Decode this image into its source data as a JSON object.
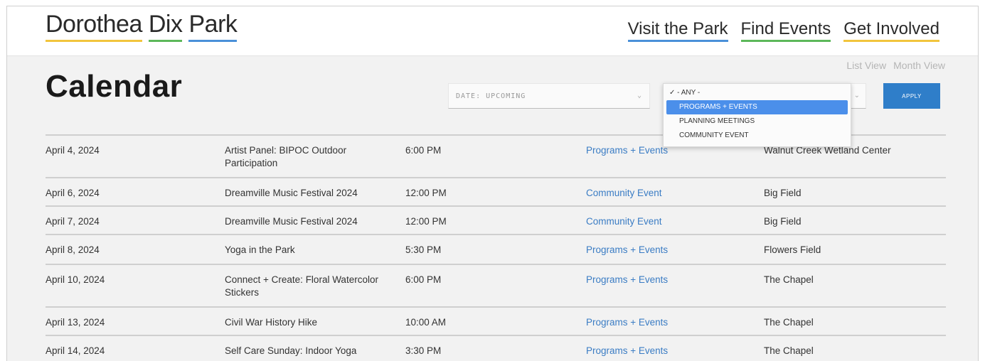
{
  "header": {
    "logo_words": [
      "Dorothea",
      "Dix",
      "Park"
    ],
    "nav": [
      "Visit the Park",
      "Find Events",
      "Get Involved"
    ]
  },
  "page": {
    "title": "Calendar",
    "views": [
      "List View",
      "Month View"
    ]
  },
  "filters": {
    "date_select_value": "DATE: UPCOMING",
    "apply_label": "APPLY",
    "type_options": [
      "✓ - ANY -",
      "PROGRAMS + EVENTS",
      "PLANNING MEETINGS",
      "COMMUNITY EVENT"
    ],
    "highlighted_option": "PROGRAMS + EVENTS"
  },
  "colors": {
    "logo_underlines": [
      "#f2c53d",
      "#5db85a",
      "#4a90d9"
    ],
    "nav_underlines": [
      "#4a90d9",
      "#5db85a",
      "#f2c53d"
    ],
    "apply_button": "#2f7ec9",
    "category_link": "#3a7cc4",
    "dropdown_highlight": "#4b8fea"
  },
  "events": [
    {
      "date": "April 4, 2024",
      "title": "Artist Panel: BIPOC Outdoor Participation",
      "time": "6:00 PM",
      "category": "Programs + Events",
      "location": "Walnut Creek Wetland Center"
    },
    {
      "date": "April 6, 2024",
      "title": "Dreamville Music Festival 2024",
      "time": "12:00 PM",
      "category": "Community Event",
      "location": "Big Field"
    },
    {
      "date": "April 7, 2024",
      "title": "Dreamville Music Festival 2024",
      "time": "12:00 PM",
      "category": "Community Event",
      "location": "Big Field"
    },
    {
      "date": "April 8, 2024",
      "title": "Yoga in the Park",
      "time": "5:30 PM",
      "category": "Programs + Events",
      "location": "Flowers Field"
    },
    {
      "date": "April 10, 2024",
      "title": "Connect + Create: Floral Watercolor Stickers",
      "time": "6:00 PM",
      "category": "Programs + Events",
      "location": "The Chapel"
    },
    {
      "date": "April 13, 2024",
      "title": "Civil War History Hike",
      "time": "10:00 AM",
      "category": "Programs + Events",
      "location": "The Chapel"
    },
    {
      "date": "April 14, 2024",
      "title": "Self Care Sunday: Indoor Yoga",
      "time": "3:30 PM",
      "category": "Programs + Events",
      "location": "The Chapel"
    }
  ]
}
